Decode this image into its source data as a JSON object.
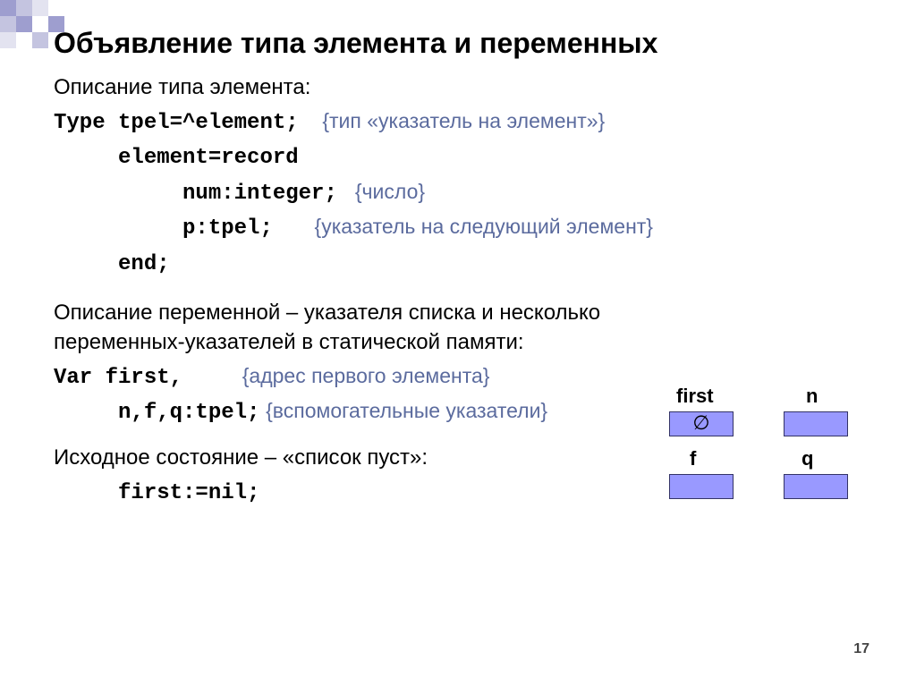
{
  "title": "Объявление типа элемента и переменных",
  "sections": {
    "type_desc_heading": "Описание типа элемента:",
    "type_line1_code": "Type tpel=^element;",
    "type_line1_comment": "{тип «указатель на элемент»}",
    "type_line2_code": "element=record",
    "type_line3_code": "num:integer;",
    "type_line3_comment": "{число}",
    "type_line4_code": "p:tpel;",
    "type_line4_comment": "{указатель на следующий элемент}",
    "type_line5_code": "end;",
    "var_desc_heading": "Описание переменной – указателя  списка  и несколько переменных-указателей в статической памяти:",
    "var_line1_code": "Var first,",
    "var_line1_comment": "{адрес первого элемента}",
    "var_line2_code": "n,f,q:tpel;",
    "var_line2_comment": "{вспомогательные указатели}",
    "state_heading": "Исходное состояние – «список пуст»:",
    "state_code": "first:=nil;"
  },
  "diagram": {
    "labels": {
      "first": "first",
      "n": "n",
      "f": "f",
      "q": "q"
    },
    "nil_symbol": "∅"
  },
  "slide_number": "17"
}
